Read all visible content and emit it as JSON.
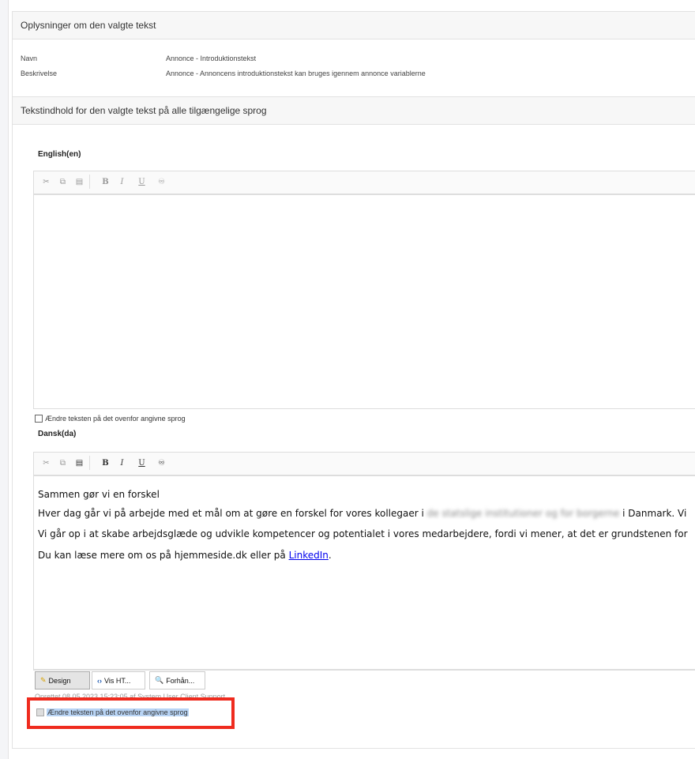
{
  "info_panel": {
    "title": "Oplysninger om den valgte tekst",
    "rows": [
      {
        "label": "Navn",
        "value": "Annonce - Introduktionstekst"
      },
      {
        "label": "Beskrivelse",
        "value": "Annonce - Annoncens introduktionstekst kan bruges igennem annonce variablerne"
      }
    ]
  },
  "content_panel": {
    "title": "Tekstindhold for den valgte tekst på alle tilgængelige sprog"
  },
  "english": {
    "label": "English(en)",
    "change_checkbox_label": "Ændre teksten på det ovenfor angivne sprog"
  },
  "danish": {
    "label": "Dansk(da)",
    "lines": {
      "l1": "Sammen gør vi en forskel",
      "l2_a": "Hver dag går vi på arbejde med et mål om at gøre en forskel for vores kollegaer i ",
      "l2_blur": "de statslige institutioner og for borgerne",
      "l2_b": " i Danmark. Vi",
      "l3": "Vi går op i at skabe arbejdsglæde og udvikle kompetencer og potentialet i vores medarbejdere, fordi vi mener, at det er grundstenen for",
      "l4_a": "Du kan læse mere om os på hjemmeside.dk eller på ",
      "l4_link": "LinkedIn",
      "l4_b": "."
    },
    "change_checkbox_label": "Ændre teksten på det ovenfor angivne sprog"
  },
  "toolbar": {
    "cut_icon": "scissors-icon",
    "copy_icon": "copy-icon",
    "paste_icon": "paste-icon",
    "bold": "B",
    "italic": "I",
    "underline": "U",
    "spell_icon": "spellcheck-icon"
  },
  "mode_tabs": {
    "design": "Design",
    "html": "Vis HT...",
    "preview": "Forhån..."
  },
  "meta_text": "Oprettet 08.05.2023 15:23:05 af System User Client Support"
}
